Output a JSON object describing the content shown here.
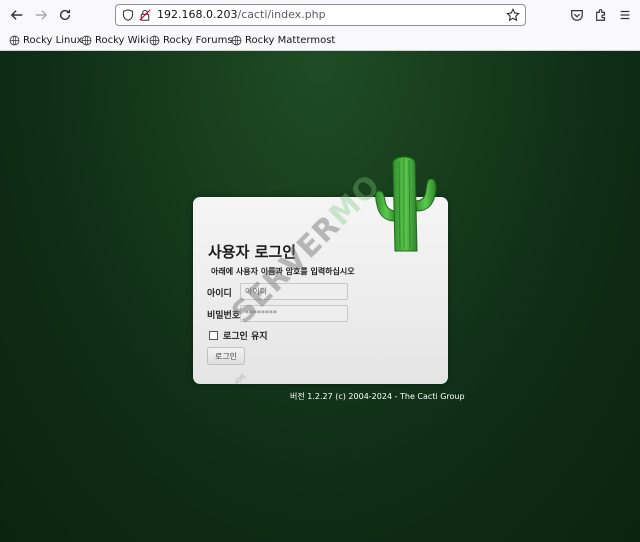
{
  "browser": {
    "url_host": "192.168.0.203",
    "url_path": "/cacti/index.php",
    "bookmarks": [
      {
        "label": "Rocky Linux"
      },
      {
        "label": "Rocky Wiki"
      },
      {
        "label": "Rocky Forums"
      },
      {
        "label": "Rocky Mattermost"
      }
    ]
  },
  "login": {
    "title": "사용자 로그인",
    "description": "아래에 사용자 이름과 암호를 입력하십시오",
    "username_label": "아이디",
    "username_placeholder": "아이디",
    "password_label": "비밀번호",
    "password_placeholder": "********",
    "remember_label": "로그인 유지",
    "remember_checked": false,
    "login_button": "로그인"
  },
  "footer": {
    "version_text": "버전 1.2.27 (c) 2004-2024 - The Cacti Group"
  },
  "watermark": {
    "text_gray": "SERVER",
    "text_green": "MO",
    "sub": "서버"
  },
  "colors": {
    "background_dark_green": "#0f2c15",
    "cactus_green": "#3fa83a",
    "card_bg": "#ececec"
  }
}
